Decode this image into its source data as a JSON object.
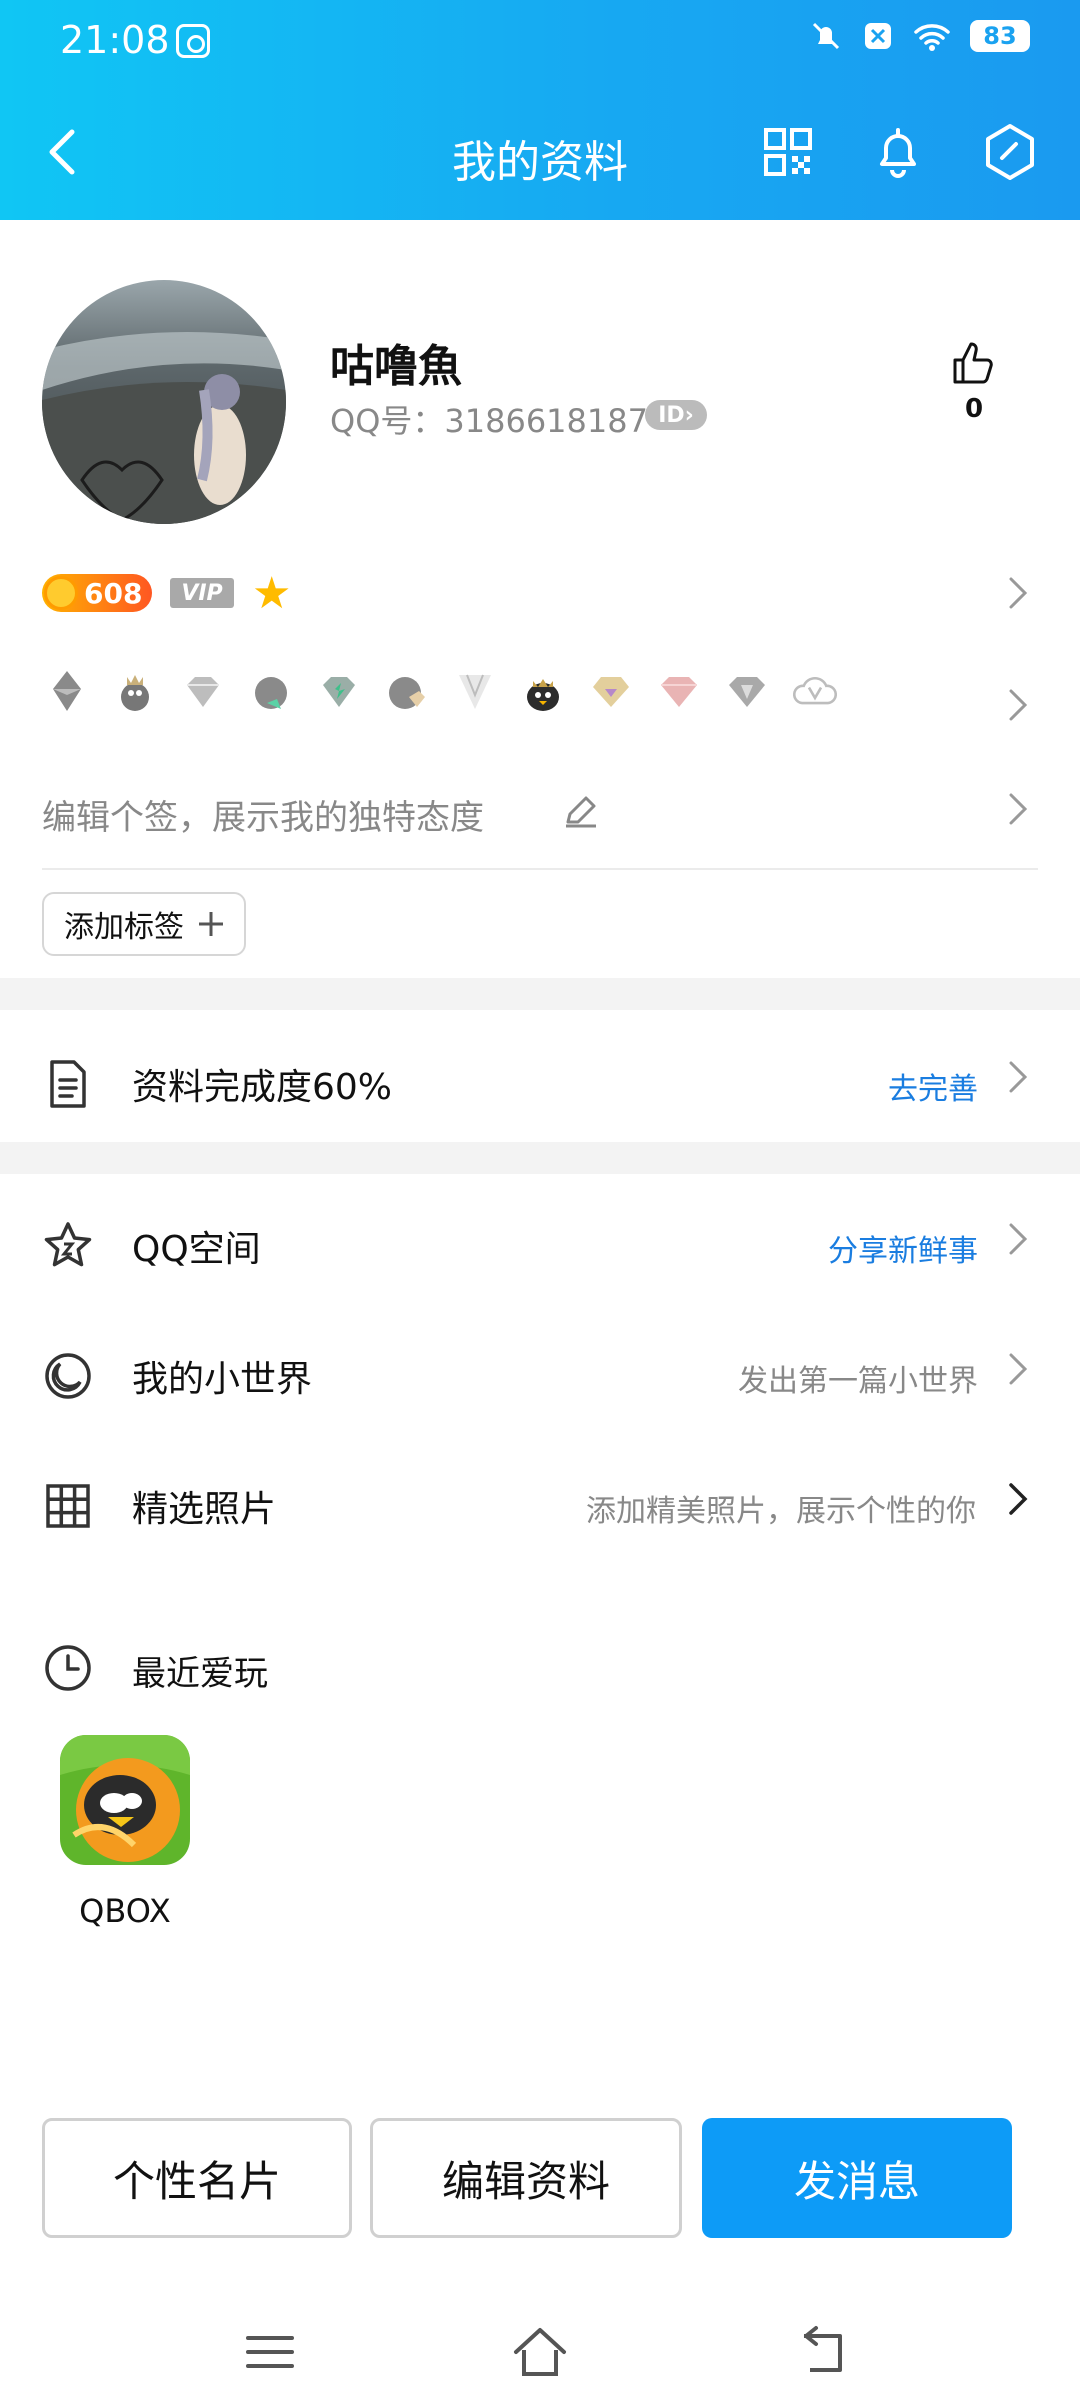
{
  "status_bar": {
    "time": "21:08",
    "battery": "83"
  },
  "nav": {
    "title": "我的资料",
    "back_icon": "chevron-left-icon",
    "qr_icon": "qr-code-icon",
    "bell_icon": "bell-icon",
    "settings_icon": "hexagon-check-icon"
  },
  "profile": {
    "name": "咕噜魚",
    "qq_number": "QQ号：3186618187",
    "id_tag": "ID",
    "likes": "0",
    "level": "608",
    "vip_tag": "VIP",
    "signature_placeholder": "编辑个签，展示我的独特态度",
    "add_tag_label": "添加标签"
  },
  "completion": {
    "label": "资料完成度60%",
    "action": "去完善"
  },
  "list": [
    {
      "label": "QQ空间",
      "right": "分享新鲜事",
      "icon": "star-icon"
    },
    {
      "label": "我的小世界",
      "right": "发出第一篇小世界",
      "icon": "moon-icon"
    },
    {
      "label": "精选照片",
      "right": "添加精美照片，展示个性的你",
      "icon": "grid-icon"
    }
  ],
  "recent": {
    "title": "最近爱玩",
    "app_label": "QBOX"
  },
  "actions": {
    "card": "个性名片",
    "edit": "编辑资料",
    "message": "发消息"
  },
  "colors": {
    "header_start": "#10c6f4",
    "header_end": "#1a9af0",
    "primary": "#0d9bf7",
    "link_blue": "#1a7de0"
  }
}
